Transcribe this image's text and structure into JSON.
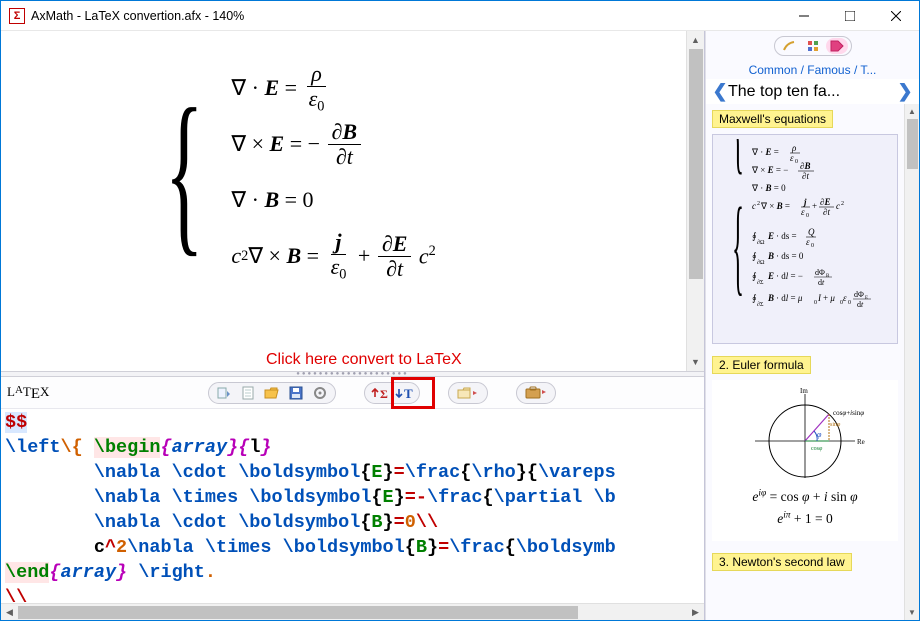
{
  "window": {
    "app_icon_text": "Σ",
    "title": "AxMath - LaTeX convertion.afx - 140%"
  },
  "callout": "Click here convert to LaTeX",
  "toolbar": {
    "label_latex": "LATEX",
    "btn_dropdown": "dropdown",
    "btn_new": "new",
    "btn_open": "open",
    "btn_save": "save",
    "btn_settings": "settings",
    "btn_to_math": "to-math",
    "btn_to_latex": "to-latex",
    "btn_folder": "folder",
    "btn_case": "briefcase",
    "highlighted": "to-latex"
  },
  "code": {
    "delim": "$$",
    "lines": [
      "\\left\\{ \\begin{array}{l}",
      "\\nabla \\cdot \\boldsymbol{E}=\\frac{\\rho}{\\vareps",
      "\\nabla \\times \\boldsymbol{E}=-\\frac{\\partial \\b",
      "\\nabla \\cdot \\boldsymbol{B}=0\\\\",
      "c^2\\nabla \\times \\boldsymbol{B}=\\frac{\\boldsymb",
      "\\end{array} \\right.",
      "\\\\"
    ],
    "indent_lines": [
      1,
      2,
      3,
      4
    ],
    "begin_env": "array",
    "end_env": "array"
  },
  "sidepanel": {
    "breadcrumb": "Common / Famous / T...",
    "header": "The top ten fa...",
    "cards": [
      {
        "label": "Maxwell's equations"
      },
      {
        "label": "2. Euler formula"
      },
      {
        "label": "3. Newton's second law"
      }
    ],
    "euler": {
      "line1_lhs_sup": "iφ",
      "line1_lhs": "e",
      "line1_rhs": " = cos φ + i sin φ",
      "line2": "e^{iπ} + 1 = 0"
    }
  },
  "equation": {
    "rows": [
      "∇ · E = ρ / ε₀",
      "∇ × E = − ∂B/∂t",
      "∇ · B = 0",
      "c² ∇ × B = j/ε₀ + (∂E/∂t) c²"
    ]
  }
}
